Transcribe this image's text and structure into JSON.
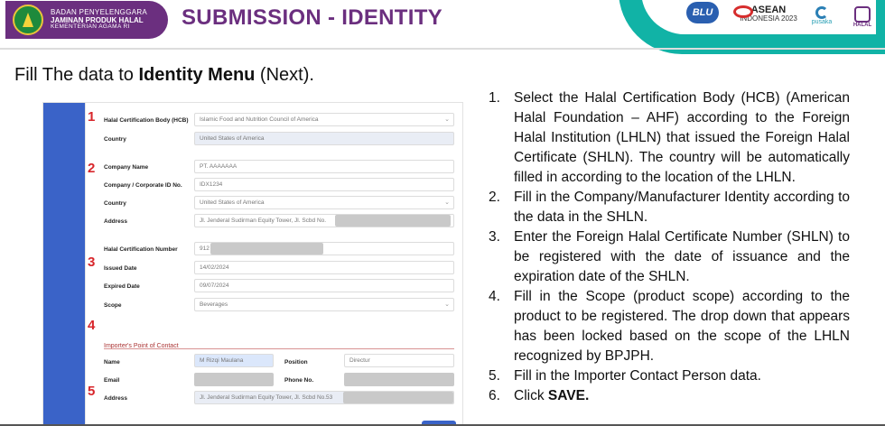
{
  "header": {
    "org_line1": "BADAN PENYELENGGARA",
    "org_line2": "JAMINAN PRODUK HALAL",
    "org_line3": "KEMENTERIAN AGAMA RI",
    "title": "SUBMISSION - IDENTITY",
    "partners": {
      "blu": "BLU",
      "asean_big": "ASEAN",
      "asean_small": "INDONESIA 2023",
      "pusaka": "pusaka",
      "halal": "HALAL"
    }
  },
  "heading": {
    "prefix": "Fill The data to ",
    "bold": "Identity Menu",
    "suffix": " (Next)."
  },
  "form": {
    "markers": [
      "1",
      "2",
      "3",
      "4",
      "5"
    ],
    "hcb_label": "Halal Certification Body (HCB)",
    "hcb_value": "Islamic Food and Nutrition Council of America",
    "country1_label": "Country",
    "country1_value": "United States of America",
    "company_label": "Company Name",
    "company_value": "PT. AAAAAAA",
    "corp_id_label": "Company / Corporate ID No.",
    "corp_id_value": "IDX1234",
    "country2_label": "Country",
    "country2_value": "United States of America",
    "address_label": "Address",
    "address_value": "Jl. Jenderal Sudirman Equity Tower, Jl. Scbd No.",
    "cert_no_label": "Halal Certification Number",
    "cert_no_value": "912",
    "issued_label": "Issued Date",
    "issued_value": "14/02/2024",
    "expired_label": "Expired Date",
    "expired_value": "09/07/2024",
    "scope_label": "Scope",
    "scope_value": "Beverages",
    "poc_title": "Importer's Point of Contact",
    "name_label": "Name",
    "name_value": "M Rizqi Maulana",
    "position_label": "Position",
    "position_value": "Directur",
    "email_label": "Email",
    "phone_label": "Phone No.",
    "poc_address_label": "Address",
    "poc_address_value": "Jl. Jenderal Sudirman Equity Tower, Jl. Scbd No.53"
  },
  "steps": [
    {
      "n": "1.",
      "text": "Select the Halal Certification Body (HCB) (American Halal Foundation – AHF) according to the Foreign Halal Institution (LHLN) that issued the Foreign Halal Certificate (SHLN). The country will be automatically filled in according to the location of the LHLN."
    },
    {
      "n": "2.",
      "text": "Fill in the Company/Manufacturer Identity according to the data in the SHLN."
    },
    {
      "n": "3.",
      "text": "Enter the Foreign Halal Certificate Number (SHLN) to be registered with the date of issuance and the expiration date of the SHLN."
    },
    {
      "n": "4.",
      "text": "Fill in the Scope (product scope) according to the product to be registered. The drop down that appears has been locked based on the scope of the LHLN recognized by BPJPH."
    },
    {
      "n": "5.",
      "text": "Fill in the Importer Contact Person data."
    },
    {
      "n": "6.",
      "text_prefix": "Click ",
      "bold": "SAVE."
    }
  ]
}
